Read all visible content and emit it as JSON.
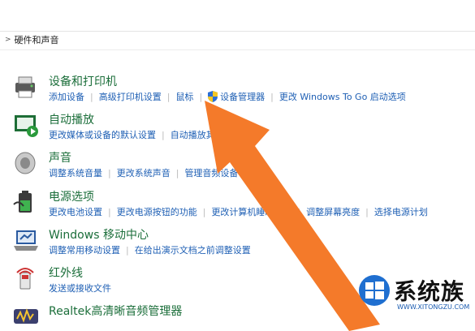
{
  "breadcrumb": {
    "label": "硬件和声音"
  },
  "categories": [
    {
      "title": "设备和打印机",
      "links": [
        "添加设备",
        "高级打印机设置",
        "鼠标",
        "设备管理器",
        "更改 Windows To Go 启动选项"
      ]
    },
    {
      "title": "自动播放",
      "links": [
        "更改媒体或设备的默认设置",
        "自动播放其他媒体"
      ]
    },
    {
      "title": "声音",
      "links": [
        "调整系统音量",
        "更改系统声音",
        "管理音频设备"
      ]
    },
    {
      "title": "电源选项",
      "links": [
        "更改电池设置",
        "更改电源按钮的功能",
        "更改计算机睡眠时间",
        "调整屏幕亮度",
        "选择电源计划"
      ]
    },
    {
      "title": "Windows 移动中心",
      "links": [
        "调整常用移动设置",
        "在给出演示文档之前调整设置"
      ]
    },
    {
      "title": "红外线",
      "links": [
        "发送或接收文件"
      ]
    },
    {
      "title": "Realtek高清晰音频管理器",
      "links": []
    }
  ],
  "watermark": {
    "brand": "系统族",
    "url": "WWW.XITONGZU.COM"
  },
  "colors": {
    "title_green": "#1b6e3a",
    "link_blue": "#1e5fb4",
    "arrow_orange": "#f47a2a"
  }
}
